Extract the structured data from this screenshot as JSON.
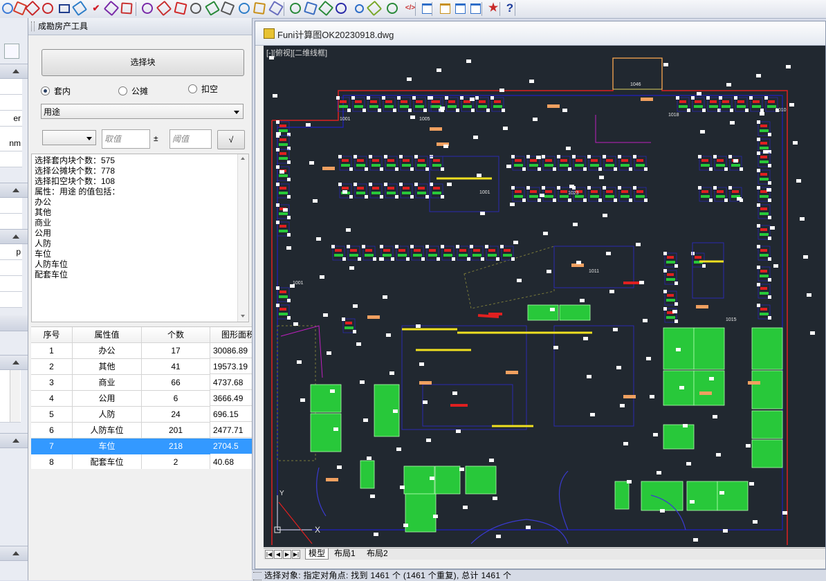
{
  "toolbar": {
    "icons": [
      "cad-tool",
      "cad-tool",
      "cad-tool",
      "cad-tool",
      "rectangle",
      "cad-tool",
      "check-mark",
      "cad-tool",
      "cad-tool",
      "cad-tool",
      "cad-tool",
      "pin",
      "cut",
      "cad-tool",
      "dimension",
      "cad-tool",
      "cad-tool",
      "cad-tool",
      "resize",
      "cad-tool",
      "refresh",
      "cad-tool",
      "zoom",
      "cad-tool",
      "cad-tool",
      "code",
      "window",
      "window",
      "window",
      "window",
      "star",
      "help"
    ],
    "help_glyph": "?",
    "code_glyph": "</>"
  },
  "left_stub": {
    "rows": [
      "",
      "",
      "er",
      "",
      "nm",
      "",
      "",
      "",
      "p",
      ""
    ]
  },
  "panel": {
    "title": "成勘房产工具",
    "select_block_label": "选择块",
    "radio": {
      "inner": "套内",
      "shared": "公摊",
      "deduct": "扣空",
      "selected": "inner"
    },
    "attribute_combo": "用途",
    "op_combo": "",
    "value_placeholder": "取值",
    "plusminus": "±",
    "threshold_placeholder": "阈值",
    "ok_label": "√",
    "info_lines": [
      "选择套内块个数：575",
      "选择公摊块个数：778",
      "选择扣空块个数：108",
      "属性：用途 的值包括：",
      "办公",
      "其他",
      "商业",
      "公用",
      "人防",
      "车位",
      "人防车位",
      "配套车位"
    ],
    "table": {
      "headers": [
        "序号",
        "属性值",
        "个数",
        "图形面积"
      ],
      "rows": [
        [
          "1",
          "办公",
          "17",
          "30086.89"
        ],
        [
          "2",
          "其他",
          "41",
          "19573.19"
        ],
        [
          "3",
          "商业",
          "66",
          "4737.68"
        ],
        [
          "4",
          "公用",
          "6",
          "3666.49"
        ],
        [
          "5",
          "人防",
          "24",
          "696.15"
        ],
        [
          "6",
          "人防车位",
          "201",
          "2477.71"
        ],
        [
          "7",
          "车位",
          "218",
          "2704.5"
        ],
        [
          "8",
          "配套车位",
          "2",
          "40.68"
        ]
      ],
      "selected_row": "7"
    }
  },
  "drawing": {
    "title": "Funi计算图OK20230918.dwg",
    "view_label": "[-][俯视][二维线框]",
    "labels": [
      "1046",
      "1011",
      "1001",
      "1001",
      "1015",
      "1010",
      "1018",
      "1005",
      "1001",
      "1023"
    ],
    "tabs": [
      "模型",
      "布局1",
      "布局2"
    ],
    "active_tab": "模型",
    "nav_glyphs": [
      "|◀",
      "◀",
      "▶",
      "▶|"
    ],
    "axis": {
      "y": "Y",
      "x": "X"
    }
  },
  "status": {
    "text": "选择对象: 指定对角点: 找到 1461 个 (1461 个重复), 总计 1461 个"
  }
}
